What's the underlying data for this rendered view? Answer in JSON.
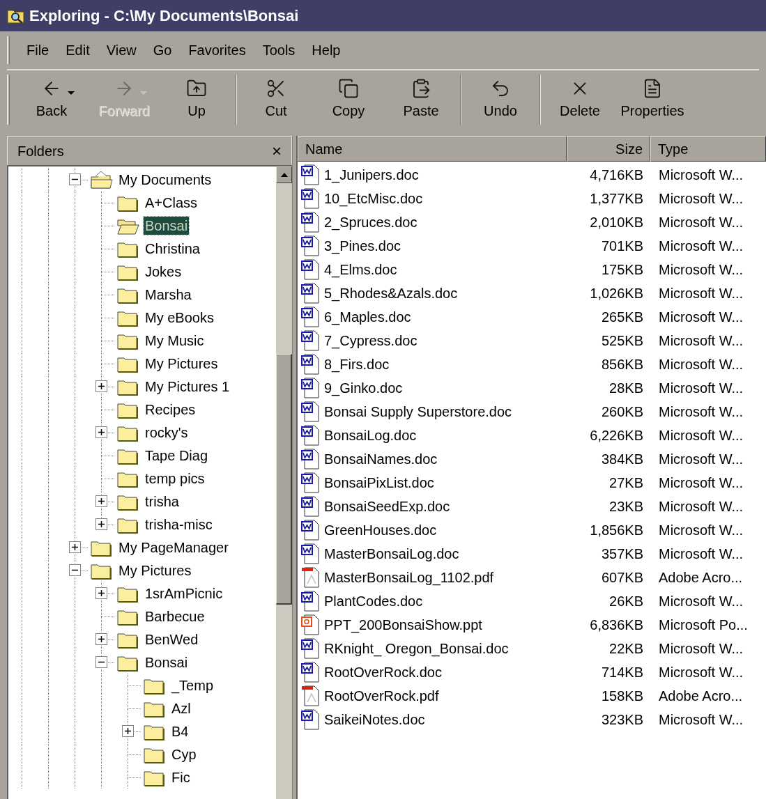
{
  "window": {
    "title": "Exploring - C:\\My Documents\\Bonsai"
  },
  "menu": [
    "File",
    "Edit",
    "View",
    "Go",
    "Favorites",
    "Tools",
    "Help"
  ],
  "toolbar": [
    [
      {
        "label": "Back",
        "disabled": false,
        "dropdown": true
      },
      {
        "label": "Forward",
        "disabled": true,
        "dropdown": true
      },
      {
        "label": "Up",
        "disabled": false,
        "dropdown": false
      }
    ],
    [
      {
        "label": "Cut",
        "disabled": false,
        "dropdown": false
      },
      {
        "label": "Copy",
        "disabled": false,
        "dropdown": false
      },
      {
        "label": "Paste",
        "disabled": false,
        "dropdown": false
      }
    ],
    [
      {
        "label": "Undo",
        "disabled": false,
        "dropdown": false
      }
    ],
    [
      {
        "label": "Delete",
        "disabled": false,
        "dropdown": false
      },
      {
        "label": "Properties",
        "disabled": false,
        "dropdown": false
      }
    ]
  ],
  "folders": {
    "title": "Folders",
    "close": "×",
    "items": [
      {
        "label": "My Documents",
        "kind": "documents",
        "selected": false,
        "expanded": true,
        "children": [
          {
            "label": "A+Class",
            "kind": "folder",
            "selected": false
          },
          {
            "label": "Bonsai",
            "kind": "folder",
            "selected": true
          },
          {
            "label": "Christina",
            "kind": "folder",
            "selected": false
          },
          {
            "label": "Jokes",
            "kind": "folder",
            "selected": false
          },
          {
            "label": "Marsha",
            "kind": "folder",
            "selected": false
          },
          {
            "label": "My eBooks",
            "kind": "folder",
            "selected": false
          },
          {
            "label": "My Music",
            "kind": "folder",
            "selected": false
          },
          {
            "label": "My Pictures",
            "kind": "folder",
            "selected": false
          },
          {
            "label": "My Pictures 1",
            "kind": "folder",
            "selected": false,
            "expanded": false
          },
          {
            "label": "Recipes",
            "kind": "folder",
            "selected": false
          },
          {
            "label": "rocky's",
            "kind": "folder",
            "selected": false,
            "expanded": false
          },
          {
            "label": "Tape Diag",
            "kind": "folder",
            "selected": false
          },
          {
            "label": "temp pics",
            "kind": "folder",
            "selected": false
          },
          {
            "label": "trisha",
            "kind": "folder",
            "selected": false,
            "expanded": false
          },
          {
            "label": "trisha-misc",
            "kind": "folder",
            "selected": false,
            "expanded": false
          }
        ]
      },
      {
        "label": "My PageManager",
        "kind": "folder",
        "selected": false,
        "expanded": false
      },
      {
        "label": "My Pictures",
        "kind": "folder",
        "selected": false,
        "expanded": true,
        "children": [
          {
            "label": "1srAmPicnic",
            "kind": "folder",
            "selected": false,
            "expanded": false
          },
          {
            "label": "Barbecue",
            "kind": "folder",
            "selected": false
          },
          {
            "label": "BenWed",
            "kind": "folder",
            "selected": false,
            "expanded": false
          },
          {
            "label": "Bonsai",
            "kind": "folder",
            "selected": false,
            "expanded": true,
            "children": [
              {
                "label": "_Temp",
                "kind": "folder",
                "selected": false
              },
              {
                "label": "Azl",
                "kind": "folder",
                "selected": false
              },
              {
                "label": "B4",
                "kind": "folder",
                "selected": false,
                "expanded": false
              },
              {
                "label": "Cyp",
                "kind": "folder",
                "selected": false
              },
              {
                "label": "Fic",
                "kind": "folder",
                "selected": false
              }
            ]
          }
        ]
      }
    ]
  },
  "files": {
    "columns": [
      "Name",
      "Size",
      "Type"
    ],
    "rows": [
      {
        "name": "1_Junipers.doc",
        "size": "4,716KB",
        "type": "Microsoft W...",
        "kind": "word"
      },
      {
        "name": "10_EtcMisc.doc",
        "size": "1,377KB",
        "type": "Microsoft W...",
        "kind": "word"
      },
      {
        "name": "2_Spruces.doc",
        "size": "2,010KB",
        "type": "Microsoft W...",
        "kind": "word"
      },
      {
        "name": "3_Pines.doc",
        "size": "701KB",
        "type": "Microsoft W...",
        "kind": "word"
      },
      {
        "name": "4_Elms.doc",
        "size": "175KB",
        "type": "Microsoft W...",
        "kind": "word"
      },
      {
        "name": "5_Rhodes&Azals.doc",
        "size": "1,026KB",
        "type": "Microsoft W...",
        "kind": "word"
      },
      {
        "name": "6_Maples.doc",
        "size": "265KB",
        "type": "Microsoft W...",
        "kind": "word"
      },
      {
        "name": "7_Cypress.doc",
        "size": "525KB",
        "type": "Microsoft W...",
        "kind": "word"
      },
      {
        "name": "8_Firs.doc",
        "size": "856KB",
        "type": "Microsoft W...",
        "kind": "word"
      },
      {
        "name": "9_Ginko.doc",
        "size": "28KB",
        "type": "Microsoft W...",
        "kind": "word"
      },
      {
        "name": "Bonsai Supply Superstore.doc",
        "size": "260KB",
        "type": "Microsoft W...",
        "kind": "word"
      },
      {
        "name": "BonsaiLog.doc",
        "size": "6,226KB",
        "type": "Microsoft W...",
        "kind": "word"
      },
      {
        "name": "BonsaiNames.doc",
        "size": "384KB",
        "type": "Microsoft W...",
        "kind": "word"
      },
      {
        "name": "BonsaiPixList.doc",
        "size": "27KB",
        "type": "Microsoft W...",
        "kind": "word"
      },
      {
        "name": "BonsaiSeedExp.doc",
        "size": "23KB",
        "type": "Microsoft W...",
        "kind": "word"
      },
      {
        "name": "GreenHouses.doc",
        "size": "1,856KB",
        "type": "Microsoft W...",
        "kind": "word"
      },
      {
        "name": "MasterBonsaiLog.doc",
        "size": "357KB",
        "type": "Microsoft W...",
        "kind": "word"
      },
      {
        "name": "MasterBonsaiLog_1102.pdf",
        "size": "607KB",
        "type": "Adobe Acro...",
        "kind": "pdf"
      },
      {
        "name": "PlantCodes.doc",
        "size": "26KB",
        "type": "Microsoft W...",
        "kind": "word"
      },
      {
        "name": "PPT_200BonsaiShow.ppt",
        "size": "6,836KB",
        "type": "Microsoft Po...",
        "kind": "ppt"
      },
      {
        "name": "RKnight_ Oregon_Bonsai.doc",
        "size": "22KB",
        "type": "Microsoft W...",
        "kind": "word"
      },
      {
        "name": "RootOverRock.doc",
        "size": "714KB",
        "type": "Microsoft W...",
        "kind": "word"
      },
      {
        "name": "RootOverRock.pdf",
        "size": "158KB",
        "type": "Adobe Acro...",
        "kind": "pdf"
      },
      {
        "name": "SaikeiNotes.doc",
        "size": "323KB",
        "type": "Microsoft W...",
        "kind": "word"
      }
    ]
  }
}
